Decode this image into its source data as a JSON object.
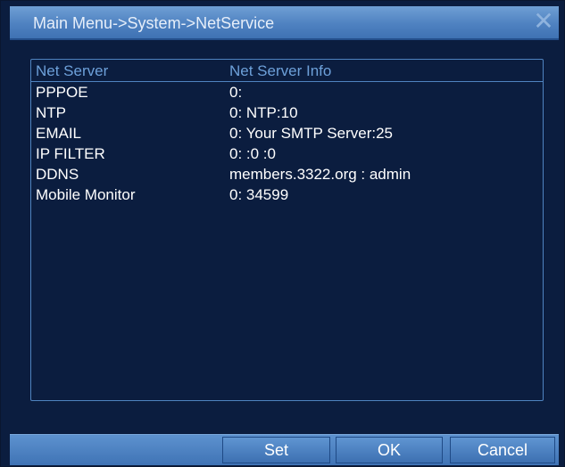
{
  "window": {
    "title": "Main Menu->System->NetService",
    "close_symbol": "✕"
  },
  "list": {
    "headers": [
      "Net Server",
      "Net Server Info"
    ],
    "rows": [
      {
        "server": "PPPOE",
        "info": "0:"
      },
      {
        "server": "NTP",
        "info": "0: NTP:10"
      },
      {
        "server": "EMAIL",
        "info": "0: Your SMTP Server:25"
      },
      {
        "server": "IP FILTER",
        "info": "0: :0 :0"
      },
      {
        "server": "DDNS",
        "info": "members.3322.org : admin"
      },
      {
        "server": "Mobile Monitor",
        "info": "0: 34599"
      }
    ]
  },
  "buttons": {
    "set": "Set",
    "ok": "OK",
    "cancel": "Cancel"
  },
  "colors": {
    "background": "#0b1d3f",
    "titlebar": "#4f82c1",
    "header_text": "#6da0d9",
    "row_text": "#ffffff"
  }
}
